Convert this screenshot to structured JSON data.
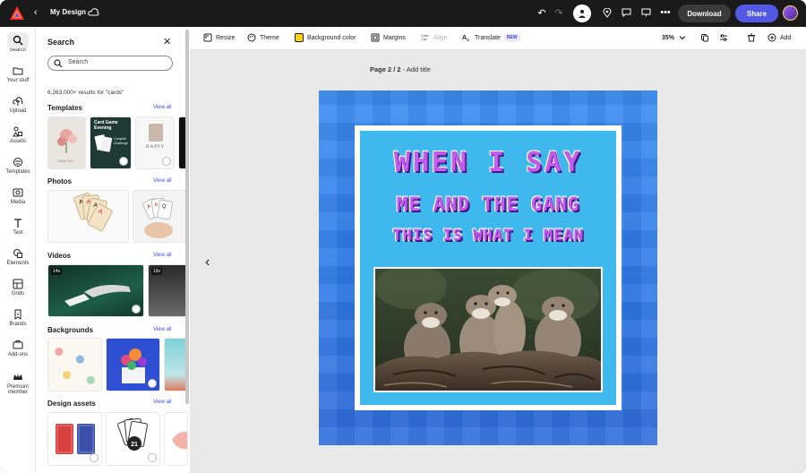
{
  "app": {
    "title": "My Design",
    "back_glyph": "‹",
    "download_label": "Download",
    "share_label": "Share",
    "colors": {
      "brand_red": "#ff2d2d",
      "share": "#5258e4",
      "topbar": "#1a1a1a"
    }
  },
  "rail": {
    "items": [
      {
        "label": "Search",
        "icon": "search-icon"
      },
      {
        "label": "Your stuff",
        "icon": "folder-icon"
      },
      {
        "label": "Upload",
        "icon": "upload-icon"
      },
      {
        "label": "Assets",
        "icon": "assets-icon"
      },
      {
        "label": "Templates",
        "icon": "templates-icon"
      },
      {
        "label": "Media",
        "icon": "media-icon"
      },
      {
        "label": "Text",
        "icon": "text-icon"
      },
      {
        "label": "Elements",
        "icon": "elements-icon"
      },
      {
        "label": "Grids",
        "icon": "grids-icon"
      },
      {
        "label": "Brands",
        "icon": "brands-icon"
      },
      {
        "label": "Add-ons",
        "icon": "addons-icon"
      },
      {
        "label": "Premium",
        "label2": "member",
        "icon": "crown-icon"
      }
    ]
  },
  "panel": {
    "title": "Search",
    "search_value": "Search",
    "results": "6,263,000+ results for \"cards\"",
    "view_all": "View all",
    "sections": {
      "templates": "Templates",
      "photos": "Photos",
      "videos": "Videos",
      "backgrounds": "Backgrounds",
      "design_assets": "Design assets"
    },
    "template_texts": {
      "t1": "Thank You",
      "t2_line1": "Card Game",
      "t2_line2": "Evening",
      "t2_line3": "Compete",
      "t2_line4": "Challenge",
      "t3_line1": "HAPPY"
    },
    "video_durations": [
      "14s",
      "19s"
    ]
  },
  "toolbar": {
    "resize": "Resize",
    "theme": "Theme",
    "background_color": "Background color",
    "margins": "Margins",
    "align": "Align",
    "translate": "Translate",
    "new_badge": "NEW",
    "zoom": "35%",
    "add": "Add"
  },
  "canvas": {
    "page_label": "Page 2 / 2",
    "page_title_placeholder": " - Add title",
    "meme": {
      "line1": "WHEN I SAY",
      "line2": "ME AND THE GANG",
      "line3": "THIS IS WHAT I MEAN"
    }
  }
}
